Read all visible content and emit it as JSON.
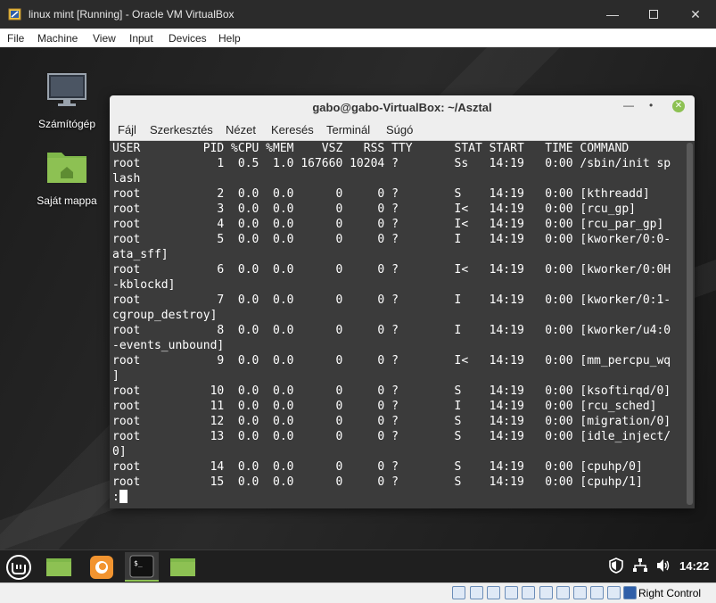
{
  "host_window": {
    "title": "linux mint [Running] - Oracle VM VirtualBox",
    "minimize_icon": "minimize-icon",
    "maximize_icon": "maximize-icon",
    "close_icon": "close-icon"
  },
  "host_menu": {
    "items": [
      "File",
      "Machine",
      "View",
      "Input",
      "Devices",
      "Help"
    ]
  },
  "desktop": {
    "icons": [
      {
        "label": "Számítógép",
        "icon": "computer-icon"
      },
      {
        "label": "Saját mappa",
        "icon": "home-folder-icon"
      }
    ]
  },
  "terminal": {
    "title": "gabo@gabo-VirtualBox: ~/Asztal",
    "menu": [
      "Fájl",
      "Szerkesztés",
      "Nézet",
      "Keresés",
      "Terminál",
      "Súgó"
    ],
    "lines": [
      "USER         PID %CPU %MEM    VSZ   RSS TTY      STAT START   TIME COMMAND",
      "root           1  0.5  1.0 167660 10204 ?        Ss   14:19   0:00 /sbin/init sp",
      "lash",
      "root           2  0.0  0.0      0     0 ?        S    14:19   0:00 [kthreadd]",
      "root           3  0.0  0.0      0     0 ?        I<   14:19   0:00 [rcu_gp]",
      "root           4  0.0  0.0      0     0 ?        I<   14:19   0:00 [rcu_par_gp]",
      "root           5  0.0  0.0      0     0 ?        I    14:19   0:00 [kworker/0:0-",
      "ata_sff]",
      "root           6  0.0  0.0      0     0 ?        I<   14:19   0:00 [kworker/0:0H",
      "-kblockd]",
      "root           7  0.0  0.0      0     0 ?        I    14:19   0:00 [kworker/0:1-",
      "cgroup_destroy]",
      "root           8  0.0  0.0      0     0 ?        I    14:19   0:00 [kworker/u4:0",
      "-events_unbound]",
      "root           9  0.0  0.0      0     0 ?        I<   14:19   0:00 [mm_percpu_wq",
      "]",
      "root          10  0.0  0.0      0     0 ?        S    14:19   0:00 [ksoftirqd/0]",
      "root          11  0.0  0.0      0     0 ?        I    14:19   0:00 [rcu_sched]",
      "root          12  0.0  0.0      0     0 ?        S    14:19   0:00 [migration/0]",
      "root          13  0.0  0.0      0     0 ?        S    14:19   0:00 [idle_inject/",
      "0]",
      "root          14  0.0  0.0      0     0 ?        S    14:19   0:00 [cpuhp/0]",
      "root          15  0.0  0.0      0     0 ?        S    14:19   0:00 [cpuhp/1]"
    ],
    "prompt": ":"
  },
  "taskbar": {
    "clock": "14:22",
    "apps": [
      "mint-menu-icon",
      "files-icon",
      "firefox-icon",
      "terminal-icon",
      "folder-icon"
    ],
    "tray": [
      "shield-icon",
      "network-icon",
      "volume-icon"
    ]
  },
  "host_status": {
    "host_key": "Right Control"
  },
  "colors": {
    "terminal_bg": "#3b3b3b",
    "mint_green": "#8dc153",
    "host_titlebar": "#2b2b2b"
  }
}
